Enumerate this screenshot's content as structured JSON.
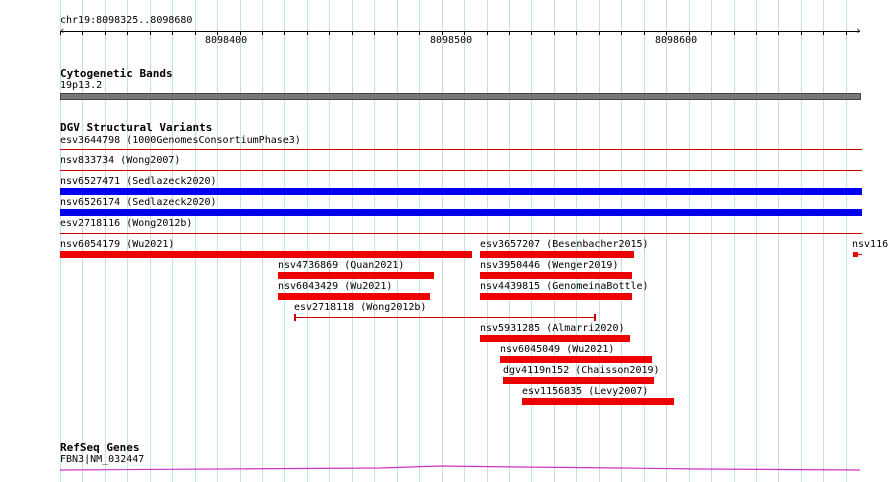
{
  "ruler": {
    "region_label": "chr19:8098325..8098680",
    "ticks": [
      "8098400",
      "8098500",
      "8098600"
    ]
  },
  "tracks": {
    "cytoband": {
      "title": "Cytogenetic Bands",
      "band_label": "19p13.2"
    },
    "dgv": {
      "title": "DGV Structural Variants",
      "features": [
        {
          "id": "dgv-1",
          "label": "esv3644798 (1000GenomesConsortiumPhase3)",
          "kind": "line",
          "color": "#cc0000"
        },
        {
          "id": "dgv-2",
          "label": "nsv833734 (Wong2007)",
          "kind": "line",
          "color": "#cc0000"
        },
        {
          "id": "dgv-3",
          "label": "nsv6527471 (Sedlazeck2020)",
          "kind": "bar",
          "color": "#0000ee"
        },
        {
          "id": "dgv-4",
          "label": "nsv6526174 (Sedlazeck2020)",
          "kind": "bar",
          "color": "#0000ee"
        },
        {
          "id": "dgv-5",
          "label": "esv2718116 (Wong2012b)",
          "kind": "line",
          "color": "#cc0000"
        },
        {
          "id": "dgv-6",
          "label": "nsv6054179 (Wu2021)",
          "kind": "bar",
          "color": "#ee0000"
        },
        {
          "id": "dgv-7",
          "label": "esv3657207 (Besenbacher2015)",
          "kind": "bar",
          "color": "#ee0000"
        },
        {
          "id": "dgv-8",
          "label": "nsv116",
          "kind": "bar",
          "color": "#ee0000"
        },
        {
          "id": "dgv-9",
          "label": "nsv4736869 (Quan2021)",
          "kind": "bar",
          "color": "#ee0000"
        },
        {
          "id": "dgv-10",
          "label": "nsv3950446 (Wenger2019)",
          "kind": "bar",
          "color": "#ee0000"
        },
        {
          "id": "dgv-11",
          "label": "nsv6043429 (Wu2021)",
          "kind": "bar",
          "color": "#ee0000"
        },
        {
          "id": "dgv-12",
          "label": "nsv4439815 (GenomeinaBottle)",
          "kind": "bar",
          "color": "#ee0000"
        },
        {
          "id": "dgv-13",
          "label": "esv2718118 (Wong2012b)",
          "kind": "span",
          "color": "#cc0000"
        },
        {
          "id": "dgv-14",
          "label": "nsv5931285 (Almarri2020)",
          "kind": "bar",
          "color": "#ee0000"
        },
        {
          "id": "dgv-15",
          "label": "nsv6045049 (Wu2021)",
          "kind": "bar",
          "color": "#ee0000"
        },
        {
          "id": "dgv-16",
          "label": "dgv4119n152 (Chaisson2019)",
          "kind": "bar",
          "color": "#ee0000"
        },
        {
          "id": "dgv-17",
          "label": "esv1156835 (Levy2007)",
          "kind": "bar",
          "color": "#ee0000"
        }
      ]
    },
    "refseq": {
      "title": "RefSeq Genes",
      "gene_label": "FBN3|NM_032447",
      "color": "#cc33cc"
    }
  },
  "colors": {
    "grid": "#bfe0f0",
    "cytoband_fill": "#777777"
  }
}
